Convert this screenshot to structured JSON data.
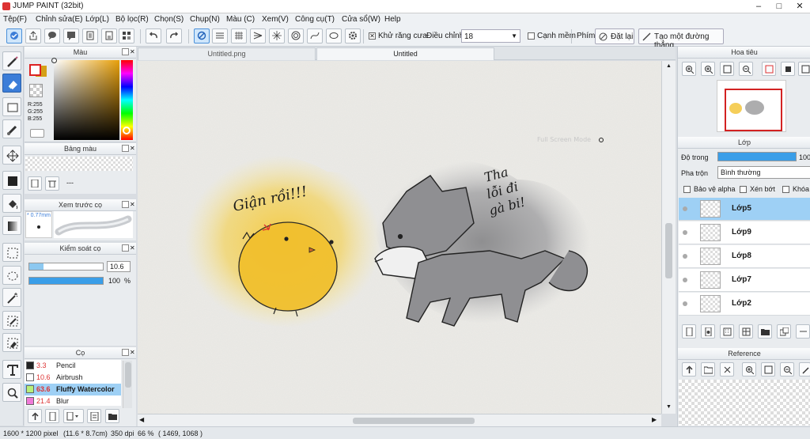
{
  "window": {
    "title": "JUMP PAINT (32bit)",
    "controls": [
      "–",
      "□",
      "✕"
    ]
  },
  "menu": [
    "Tệp(F)",
    "Chỉnh sửa(E)",
    "Lớp(L)",
    "Bộ lọc(R)",
    "Chọn(S)",
    "Chụp(N)",
    "Màu (C)",
    "Xem(V)",
    "Công cụ(T)",
    "Cửa sổ(W)",
    "Help"
  ],
  "toolbar": {
    "antialias_label": "Khử răng cưa",
    "adjust_label": "Điều chỉnh",
    "adjust_value": "18",
    "soft_edge_label": "Cạnh mềm",
    "key_label": "Phím",
    "reset_label": "Đặt lại",
    "line_label": "Tạo một đường thẳng"
  },
  "tabs": [
    "Untitled.png",
    "Untitled"
  ],
  "color_panel": {
    "title": "Màu",
    "r": "R:255",
    "g": "G:255",
    "b": "B:255"
  },
  "palette_panel": {
    "title": "Bảng màu",
    "empty": "---"
  },
  "brush_preview_panel": {
    "title": "Xem trước cọ",
    "size": "* 0.77mm"
  },
  "brush_control_panel": {
    "title": "Kiểm soát cọ",
    "size_value": "10.6",
    "opacity_value": "100",
    "opacity_unit": "%",
    "opacity_level": 1.0
  },
  "brush_panel": {
    "title": "Cọ",
    "items": [
      {
        "size": "3.3",
        "name": "Pencil",
        "swatch": "#222222"
      },
      {
        "size": "10.6",
        "name": "Airbrush",
        "swatch": "#ffffff"
      },
      {
        "size": "63.6",
        "name": "Fluffy Watercolor",
        "swatch": "#b8f07a"
      },
      {
        "size": "21.4",
        "name": "Blur",
        "swatch": "#f07ad8"
      }
    ]
  },
  "canvas_text": {
    "chick_caption": "Giận rồi!!!",
    "wolf_caption_1": "Tha",
    "wolf_caption_2": "lỗi đi",
    "wolf_caption_3": "gà bi!",
    "watermark": "Full Screen Mode"
  },
  "navigator_panel": {
    "title": "Hoa tiêu"
  },
  "layer_panel": {
    "title": "Lớp",
    "opacity_label": "Độ trong",
    "opacity_value": "100",
    "blend_label": "Pha trộn",
    "blend_value": "Bình thường",
    "protect_alpha": "Bảo vệ alpha",
    "clipping": "Xén bớt",
    "lock": "Khóa",
    "layers": [
      {
        "name": "Lớp5",
        "selected": true
      },
      {
        "name": "Lớp9",
        "selected": false
      },
      {
        "name": "Lớp8",
        "selected": false
      },
      {
        "name": "Lớp7",
        "selected": false
      },
      {
        "name": "Lớp2",
        "selected": false
      }
    ]
  },
  "reference_panel": {
    "title": "Reference"
  },
  "status": {
    "size": "1600 * 1200 pixel",
    "dims": "(11.6 * 8.7cm)",
    "dpi": "350 dpi",
    "zoom": "66 %",
    "coords": "( 1469, 1068 )"
  },
  "colors": {
    "accent": "#3b7dd8",
    "selected_layer": "#9ed0f5",
    "chick": "#f2c230",
    "wolf": "#8a8a8c"
  }
}
